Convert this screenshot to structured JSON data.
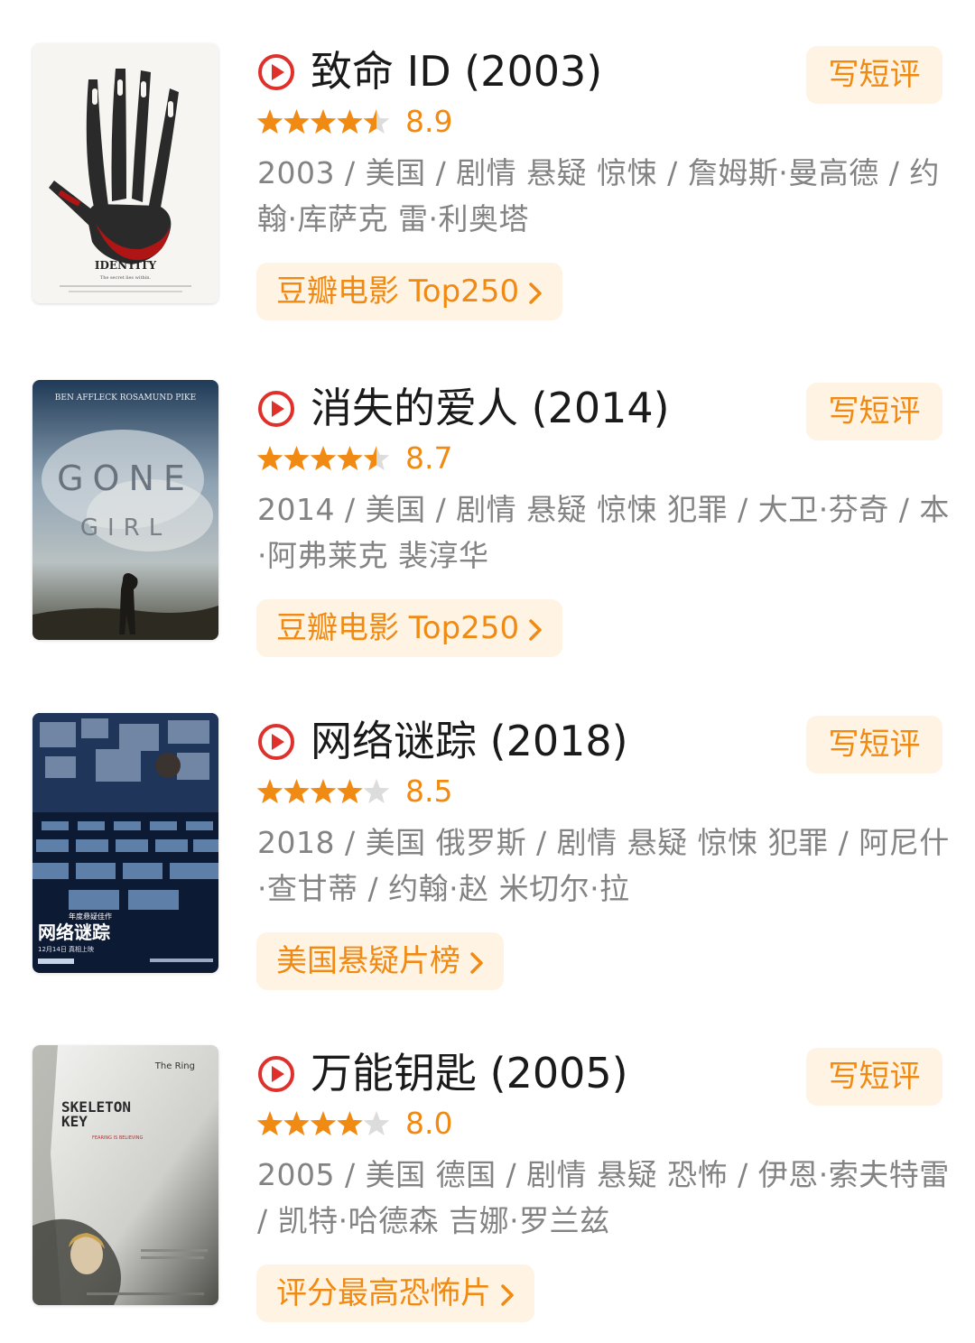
{
  "accent_color": "#f08a12",
  "button_bg": "#fff3e3",
  "star_empty_color": "#dcdcdc",
  "movies": [
    {
      "title": "致命 ID (2003)",
      "rating": 8.9,
      "rating_text": "8.9",
      "stars_filled": 4.5,
      "meta": "2003 / 美国 / 剧情 悬疑 惊悚 / 詹姆斯·曼高德 / 约翰·库萨克 雷·利奥塔",
      "review_label": "写短评",
      "list_label": "豆瓣电影 Top250",
      "poster_text": {
        "title": "IDENTITY",
        "tagline": "The secret lies within."
      }
    },
    {
      "title": "消失的爱人 (2014)",
      "rating": 8.7,
      "rating_text": "8.7",
      "stars_filled": 4.5,
      "meta": "2014 / 美国 / 剧情 悬疑 惊悚 犯罪 / 大卫·芬奇 / 本·阿弗莱克 裴淳华",
      "review_label": "写短评",
      "list_label": "豆瓣电影 Top250",
      "poster_text": {
        "actors": "BEN AFFLECK   ROSAMUND PIKE",
        "line1": "GONE",
        "line2": "GIRL"
      }
    },
    {
      "title": "网络谜踪 (2018)",
      "rating": 8.5,
      "rating_text": "8.5",
      "stars_filled": 4,
      "meta": "2018 / 美国 俄罗斯 / 剧情 悬疑 惊悚 犯罪 / 阿尼什·查甘蒂 / 约翰·赵 米切尔·拉",
      "review_label": "写短评",
      "list_label": "美国悬疑片榜",
      "poster_text": {
        "kicker": "年度悬疑佳作",
        "title": "网络谜踪",
        "date": "12月14日 真相上映"
      }
    },
    {
      "title": "万能钥匙 (2005)",
      "rating": 8.0,
      "rating_text": "8.0",
      "stars_filled": 4,
      "meta": "2005 / 美国 德国 / 剧情 悬疑 恐怖 / 伊恩·索夫特雷 / 凯特·哈德森 吉娜·罗兰兹",
      "review_label": "写短评",
      "list_label": "评分最高恐怖片",
      "poster_text": {
        "top": "The Ring",
        "line1": "SKELETON",
        "line2": "KEY",
        "tagline": "FEARING IS BELIEVING"
      }
    }
  ]
}
